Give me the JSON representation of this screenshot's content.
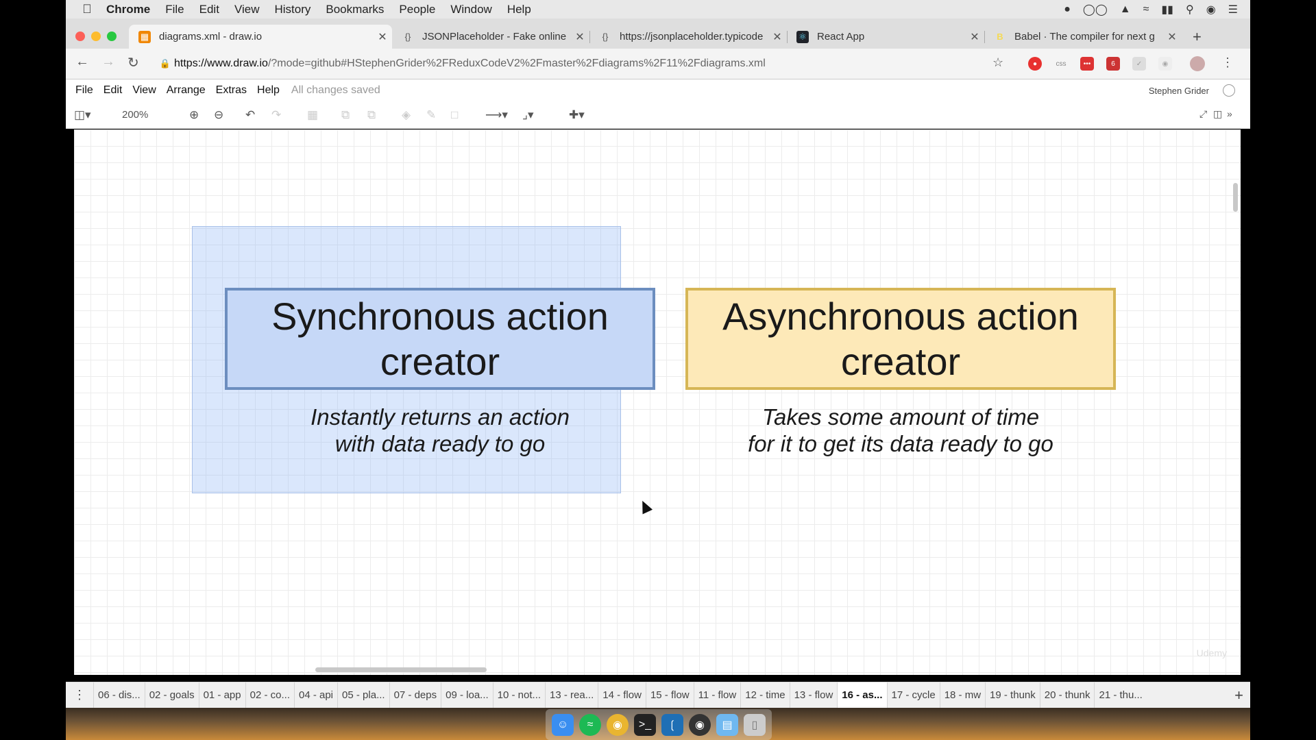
{
  "menubar": {
    "app": "Chrome",
    "items": [
      "File",
      "Edit",
      "View",
      "History",
      "Bookmarks",
      "People",
      "Window",
      "Help"
    ]
  },
  "tabs": [
    {
      "title": "diagrams.xml - draw.io",
      "icon": "drawio-icon",
      "active": true
    },
    {
      "title": "JSONPlaceholder - Fake online",
      "icon": "jsonplaceholder-icon",
      "active": false
    },
    {
      "title": "https://jsonplaceholder.typicode",
      "icon": "jsonplaceholder-icon",
      "active": false
    },
    {
      "title": "React App",
      "icon": "react-icon",
      "active": false
    },
    {
      "title": "Babel · The compiler for next g",
      "icon": "babel-icon",
      "active": false
    }
  ],
  "address": {
    "host": "https://www.draw.io",
    "path": "/?mode=github#HStephenGrider%2FReduxCodeV2%2Fmaster%2Fdiagrams%2F11%2Fdiagrams.xml"
  },
  "extensions": {
    "css_label": "css",
    "badge": "6"
  },
  "drawio": {
    "menu": [
      "File",
      "Edit",
      "View",
      "Arrange",
      "Extras",
      "Help"
    ],
    "status": "All changes saved",
    "user": "Stephen Grider",
    "zoom": "200%"
  },
  "diagram": {
    "sync_title": "Synchronous action creator",
    "sync_caption": "Instantly returns an action\nwith data ready to go",
    "async_title": "Asynchronous action creator",
    "async_caption": "Takes some amount of time\nfor it to get its data ready to go",
    "sync_fill": "#c6d8f7",
    "sync_stroke": "#6c8ebf",
    "async_fill": "#fde9b8",
    "async_stroke": "#d6b656",
    "watermark": "Udemy"
  },
  "pages": [
    "06 - dis...",
    "02 - goals",
    "01 - app",
    "02 - co...",
    "04 - api",
    "05 - pla...",
    "07 - deps",
    "09 - loa...",
    "10 - not...",
    "13 - rea...",
    "14 - flow",
    "15 - flow",
    "11 - flow",
    "12 - time",
    "13 - flow",
    "16 - as...",
    "17 - cycle",
    "18 - mw",
    "19 - thunk",
    "20 - thunk",
    "21 - thu..."
  ],
  "active_page": "16 - as..."
}
